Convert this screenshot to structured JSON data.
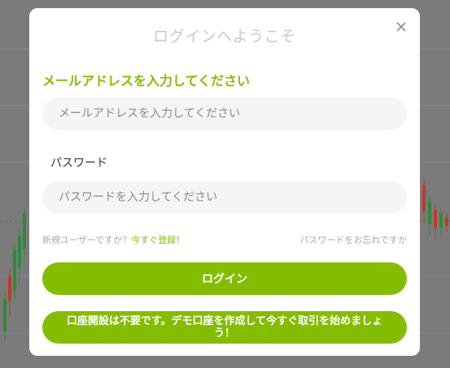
{
  "modal": {
    "title": "ログインへようこそ",
    "email_label": "メールアドレスを入力してください",
    "email_placeholder": "メールアドレスを入力してください",
    "password_label": "パスワード",
    "password_placeholder": "パスワードを入力してください",
    "new_user_text": "新規ユーザーですか？",
    "register_link": "今すぐ登録！",
    "forgot_password": "パスワードをお忘れですか",
    "login_button": "ログイン",
    "demo_button": "口座開設は不要です。デモ口座を作成して今すぐ取引を始めましょう！"
  },
  "colors": {
    "accent": "#84bd00",
    "overlay": "#7b7b7b",
    "candle_up": "#2e8b3a",
    "candle_down": "#c0392b"
  },
  "icons": {
    "close": "close-icon"
  }
}
